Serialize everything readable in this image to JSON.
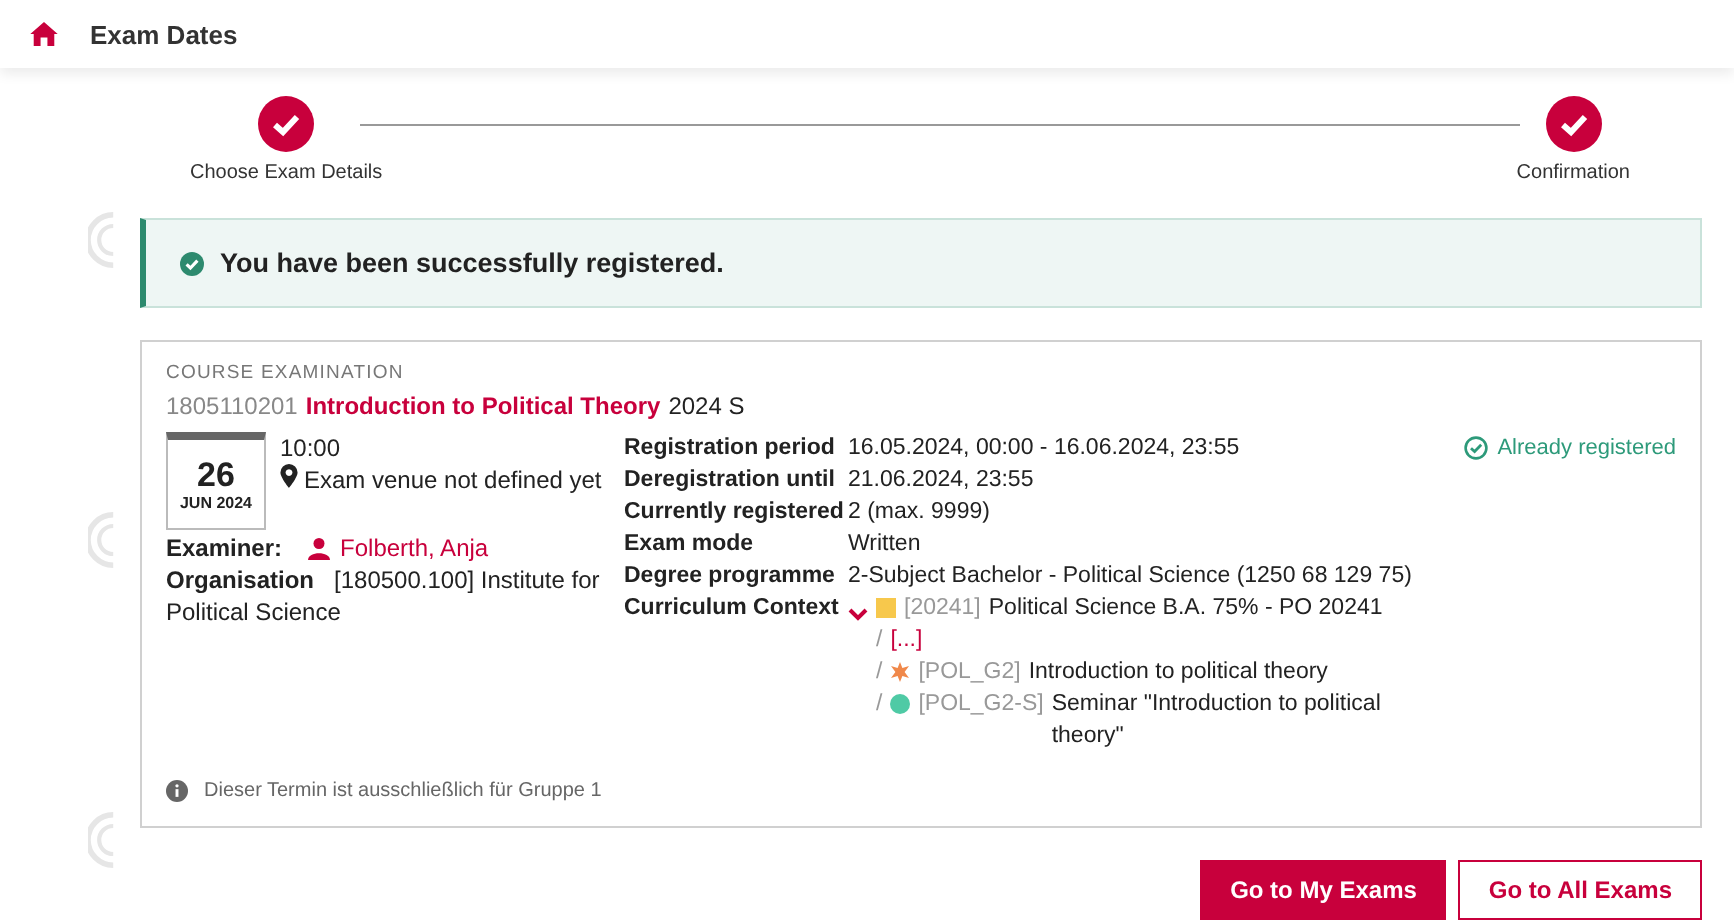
{
  "header": {
    "title": "Exam Dates"
  },
  "steps": [
    {
      "label": "Choose Exam Details",
      "done": true
    },
    {
      "label": "Confirmation",
      "done": true
    }
  ],
  "alert": {
    "message": "You have been successfully registered."
  },
  "exam": {
    "type_label": "COURSE EXAMINATION",
    "number": "1805110201",
    "title": "Introduction to Political Theory",
    "term": "2024 S",
    "day": "26",
    "month_year": "JUN 2024",
    "time": "10:00",
    "venue": "Exam venue not defined yet",
    "examiner_label": "Examiner:",
    "examiner": "Folberth, Anja",
    "organisation_label": "Organisation",
    "organisation": "[180500.100] Institute for Political Science",
    "details": [
      {
        "label": "Registration period",
        "value": "16.05.2024, 00:00 - 16.06.2024, 23:55"
      },
      {
        "label": "Deregistration until",
        "value": "21.06.2024, 23:55"
      },
      {
        "label": "Currently registered",
        "value": "2 (max. 9999)"
      },
      {
        "label": "Exam mode",
        "value": "Written"
      },
      {
        "label": "Degree programme",
        "value": "2-Subject Bachelor - Political Science (1250 68 129 75)"
      }
    ],
    "curriculum_label": "Curriculum Context",
    "curriculum_expanded": true,
    "curriculum": [
      {
        "kind": "square",
        "color": "#f7c84c",
        "code": "[20241]",
        "title": "Political Science B.A. 75% - PO 20241"
      },
      {
        "kind": "ellipsis",
        "text": "[...]"
      },
      {
        "kind": "star",
        "color": "#f0884a",
        "code": "[POL_G2]",
        "title": "Introduction to political theory"
      },
      {
        "kind": "circle",
        "color": "#4fcaa5",
        "code": "[POL_G2-S]",
        "title": "Seminar \"Introduction to political theory\""
      }
    ],
    "separator": "/",
    "status": "Already registered",
    "note": "Dieser Termin ist ausschließlich für Gruppe 1"
  },
  "buttons": [
    {
      "label": "Go to My Exams",
      "primary": true
    },
    {
      "label": "Go to All Exams",
      "primary": false
    }
  ]
}
